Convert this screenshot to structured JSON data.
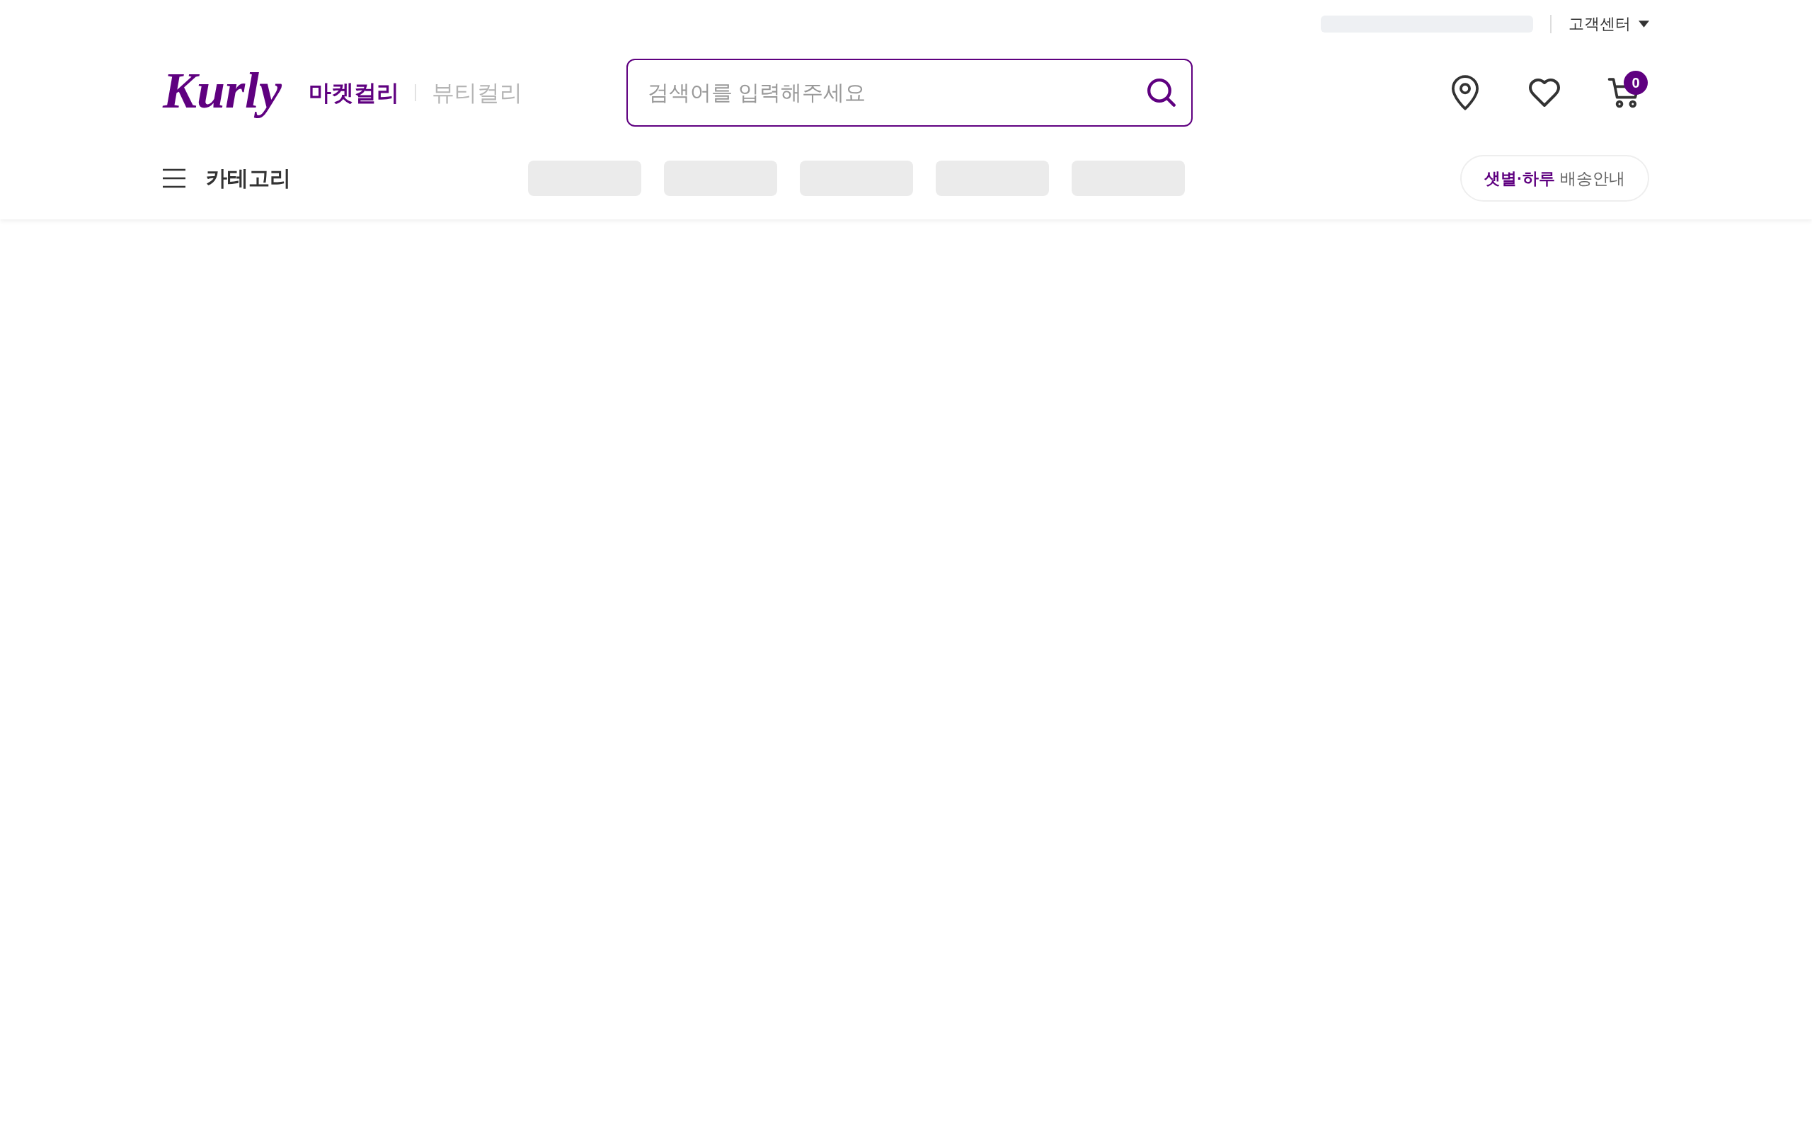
{
  "top_bar": {
    "customer_center": "고객센터"
  },
  "logo": "Kurly",
  "services": [
    {
      "label": "마켓컬리",
      "selected": true
    },
    {
      "label": "뷰티컬리",
      "selected": false
    }
  ],
  "search": {
    "placeholder": "검색어를 입력해주세요"
  },
  "cart": {
    "count": "0"
  },
  "category_menu": {
    "label": "카테고리"
  },
  "delivery_guide": {
    "highlight": "샛별·하루",
    "label": "배송안내"
  }
}
